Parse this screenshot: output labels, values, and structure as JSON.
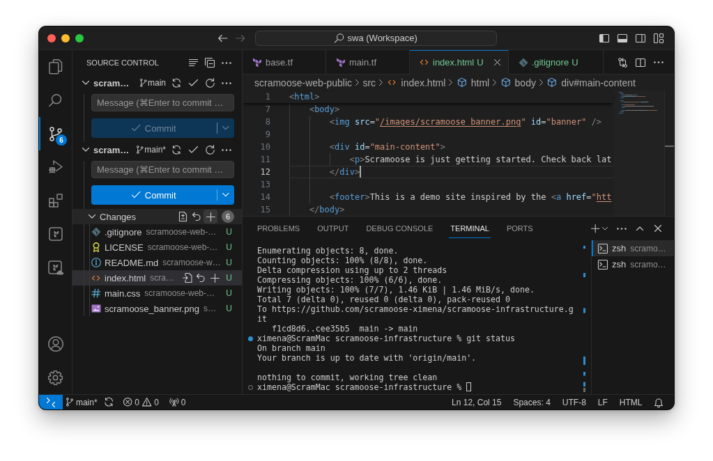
{
  "title_bar": {
    "nav": [
      {
        "kind": "back",
        "disabled": false
      },
      {
        "kind": "forward",
        "disabled": true
      }
    ],
    "command_center": {
      "label": "swa (Workspace)"
    },
    "layout_toggles": [
      {
        "kind": "primary_sidebar",
        "on": true
      },
      {
        "kind": "panel",
        "on": true
      },
      {
        "kind": "secondary_sidebar",
        "on": false
      },
      {
        "kind": "customize"
      }
    ]
  },
  "activity_bar": {
    "items": [
      {
        "kind": "explorer",
        "selected": false
      },
      {
        "kind": "search",
        "selected": false
      },
      {
        "kind": "source_control",
        "selected": true,
        "badge": "6"
      },
      {
        "kind": "run_debug",
        "selected": false
      },
      {
        "kind": "extensions",
        "selected": false
      },
      {
        "kind": "terraform",
        "selected": false
      },
      {
        "kind": "terraform_cloud",
        "selected": false
      }
    ],
    "bottom_items": [
      {
        "kind": "account"
      },
      {
        "kind": "settings"
      }
    ]
  },
  "sidebar": {
    "title": "SOURCE CONTROL",
    "repositories": [
      {
        "name": "scram…",
        "branch": "main",
        "expanded": true,
        "message": {
          "placeholder": "Message (⌘Enter to commit …"
        },
        "commit_button": {
          "label": "Commit",
          "disabled": true
        }
      },
      {
        "name": "scram…",
        "branch": "main*",
        "expanded": true,
        "message": {
          "placeholder": "Message (⌘Enter to commit …"
        },
        "commit_button": {
          "label": "Commit",
          "disabled": false
        },
        "changes": {
          "title": "Changes",
          "count": "6",
          "expanded": true,
          "actions": [
            {
              "kind": "open_changes",
              "hovered": false
            },
            {
              "kind": "discard",
              "hovered": false
            },
            {
              "kind": "stage_all",
              "hovered": true
            }
          ],
          "files": [
            {
              "kind": "git",
              "name": ".gitignore",
              "path": "scramoose-web-…",
              "status": "U",
              "selected": false
            },
            {
              "kind": "license",
              "name": "LICENSE",
              "path": "scramoose-web-…",
              "status": "U",
              "selected": false
            },
            {
              "kind": "readme",
              "name": "README.md",
              "path": "scramoose-w…",
              "status": "U",
              "selected": false
            },
            {
              "kind": "html",
              "name": "index.html",
              "path": "scra…",
              "status": "U",
              "selected": true
            },
            {
              "kind": "css",
              "name": "main.css",
              "path": "scramoose-web-…",
              "status": "U",
              "selected": false
            },
            {
              "kind": "image",
              "name": "scramoose_banner.png",
              "path": "s…",
              "status": "U",
              "selected": false
            }
          ]
        }
      }
    ]
  },
  "editor": {
    "tabs": [
      {
        "kind": "terraform",
        "label": "base.tf",
        "selected": false
      },
      {
        "kind": "terraform",
        "label": "main.tf",
        "selected": false
      },
      {
        "kind": "html",
        "label": "index.html",
        "status": "U",
        "selected": true
      },
      {
        "kind": "git",
        "label": ".gitignore",
        "status": "U",
        "selected": false
      }
    ],
    "breadcrumbs": [
      {
        "kind": "folder",
        "text": "scramoose-web-public"
      },
      {
        "kind": "folder",
        "text": "src"
      },
      {
        "kind": "html_file",
        "text": "index.html"
      },
      {
        "kind": "element",
        "text": "html"
      },
      {
        "kind": "element",
        "text": "body"
      },
      {
        "kind": "element",
        "text": "div#main-content"
      }
    ],
    "sticky_line": {
      "number": "1",
      "tokens": [
        {
          "kind": "bracket",
          "text": "<"
        },
        {
          "kind": "tag",
          "text": "html"
        },
        {
          "kind": "bracket",
          "text": ">"
        }
      ]
    },
    "lines": [
      {
        "number": "7",
        "selected": false,
        "tokens": [
          {
            "kind": "bracket",
            "text": "    <"
          },
          {
            "kind": "tag",
            "text": "body"
          },
          {
            "kind": "bracket",
            "text": ">"
          }
        ]
      },
      {
        "number": "8",
        "selected": false,
        "tokens": [
          {
            "kind": "bracket",
            "text": "        <"
          },
          {
            "kind": "tag",
            "text": "img"
          },
          {
            "kind": "attribute",
            "text": " src"
          },
          {
            "kind": "operator",
            "text": "="
          },
          {
            "kind": "string",
            "text": "\""
          },
          {
            "kind": "link",
            "text": "/images/scramoose_banner.png"
          },
          {
            "kind": "string",
            "text": "\""
          },
          {
            "kind": "attribute",
            "text": " id"
          },
          {
            "kind": "operator",
            "text": "="
          },
          {
            "kind": "string",
            "text": "\"banner\""
          },
          {
            "kind": "bracket",
            "text": " />"
          }
        ]
      },
      {
        "number": "9",
        "selected": false
      },
      {
        "number": "10",
        "selected": false,
        "tokens": [
          {
            "kind": "bracket",
            "text": "        <"
          },
          {
            "kind": "tag",
            "text": "div"
          },
          {
            "kind": "attribute",
            "text": " id"
          },
          {
            "kind": "operator",
            "text": "="
          },
          {
            "kind": "string",
            "text": "\"main-content\""
          },
          {
            "kind": "bracket",
            "text": ">"
          }
        ]
      },
      {
        "number": "11",
        "selected": false,
        "tokens": [
          {
            "kind": "bracket",
            "text": "            <"
          },
          {
            "kind": "tag",
            "text": "p"
          },
          {
            "kind": "bracket",
            "text": ">"
          },
          {
            "kind": "text",
            "text": "Scramoose is just getting started. Check back lat"
          }
        ]
      },
      {
        "number": "12",
        "selected": true,
        "tokens": [
          {
            "kind": "bracket",
            "text": "        </"
          },
          {
            "kind": "tag",
            "text": "div"
          },
          {
            "kind": "bracket",
            "text": ">"
          }
        ]
      },
      {
        "number": "13",
        "selected": false
      },
      {
        "number": "14",
        "selected": false,
        "tokens": [
          {
            "kind": "bracket",
            "text": "        <"
          },
          {
            "kind": "tag",
            "text": "footer"
          },
          {
            "kind": "bracket",
            "text": ">"
          },
          {
            "kind": "text",
            "text": "This is a demo site inspired by the "
          },
          {
            "kind": "bracket",
            "text": "<"
          },
          {
            "kind": "tag",
            "text": "a"
          },
          {
            "kind": "attribute",
            "text": " href"
          },
          {
            "kind": "operator",
            "text": "="
          },
          {
            "kind": "string",
            "text": "\""
          },
          {
            "kind": "link",
            "text": "htt"
          }
        ]
      },
      {
        "number": "15",
        "selected": false,
        "tokens": [
          {
            "kind": "bracket",
            "text": "    </"
          },
          {
            "kind": "tag",
            "text": "body"
          },
          {
            "kind": "bracket",
            "text": ">"
          }
        ]
      }
    ]
  },
  "panel": {
    "tabs": [
      {
        "label": "PROBLEMS",
        "selected": false
      },
      {
        "label": "OUTPUT",
        "selected": false
      },
      {
        "label": "DEBUG CONSOLE",
        "selected": false
      },
      {
        "label": "TERMINAL",
        "selected": true
      },
      {
        "label": "PORTS",
        "selected": false
      }
    ],
    "terminal": {
      "lines": [
        {
          "kind": "output",
          "text": "Enumerating objects: 8, done.",
          "cursor": false
        },
        {
          "kind": "output",
          "text": "Counting objects: 100% (8/8), done.",
          "cursor": false
        },
        {
          "kind": "output",
          "text": "Delta compression using up to 2 threads",
          "cursor": false
        },
        {
          "kind": "output",
          "text": "Compressing objects: 100% (6/6), done.",
          "cursor": false
        },
        {
          "kind": "output",
          "text": "Writing objects: 100% (7/7), 1.46 KiB | 1.46 MiB/s, done.",
          "cursor": false
        },
        {
          "kind": "output",
          "text": "Total 7 (delta 0), reused 0 (delta 0), pack-reused 0",
          "cursor": false
        },
        {
          "kind": "output",
          "text": "To https://github.com/scramoose-ximena/scramoose-infrastructure.g",
          "cursor": false
        },
        {
          "kind": "output",
          "text": "it",
          "cursor": false
        },
        {
          "kind": "output",
          "text": "   f1cd8d6..cee35b5  main -> main",
          "cursor": false
        },
        {
          "kind": "command",
          "completed": true,
          "text": "ximena@ScramMac scramoose-infrastructure % git status",
          "cursor": false
        },
        {
          "kind": "output",
          "text": "On branch main",
          "cursor": false
        },
        {
          "kind": "output",
          "text": "Your branch is up to date with 'origin/main'.",
          "cursor": false
        },
        {
          "kind": "output",
          "cursor": false
        },
        {
          "kind": "output",
          "text": "nothing to commit, working tree clean",
          "cursor": false
        },
        {
          "kind": "command",
          "completed": false,
          "text": "ximena@ScramMac scramoose-infrastructure % ",
          "cursor": true
        }
      ]
    },
    "sessions": [
      {
        "name": "zsh",
        "detail": "scramo…",
        "selected": true
      },
      {
        "name": "zsh",
        "detail": "scramo…",
        "selected": false
      }
    ]
  },
  "status_bar": {
    "left": [
      {
        "kind": "remote"
      },
      {
        "kind": "branch",
        "text": "main*"
      },
      {
        "kind": "sync"
      },
      {
        "kind": "problems",
        "errors": "0",
        "warnings": "0"
      },
      {
        "kind": "ports",
        "text": "0"
      }
    ],
    "right": [
      {
        "kind": "position",
        "text": "Ln 12, Col 15"
      },
      {
        "kind": "indentation",
        "text": "Spaces: 4"
      },
      {
        "kind": "encoding",
        "text": "UTF-8"
      },
      {
        "kind": "line_ending",
        "text": "LF"
      },
      {
        "kind": "language",
        "text": "HTML"
      },
      {
        "kind": "notifications"
      }
    ]
  }
}
